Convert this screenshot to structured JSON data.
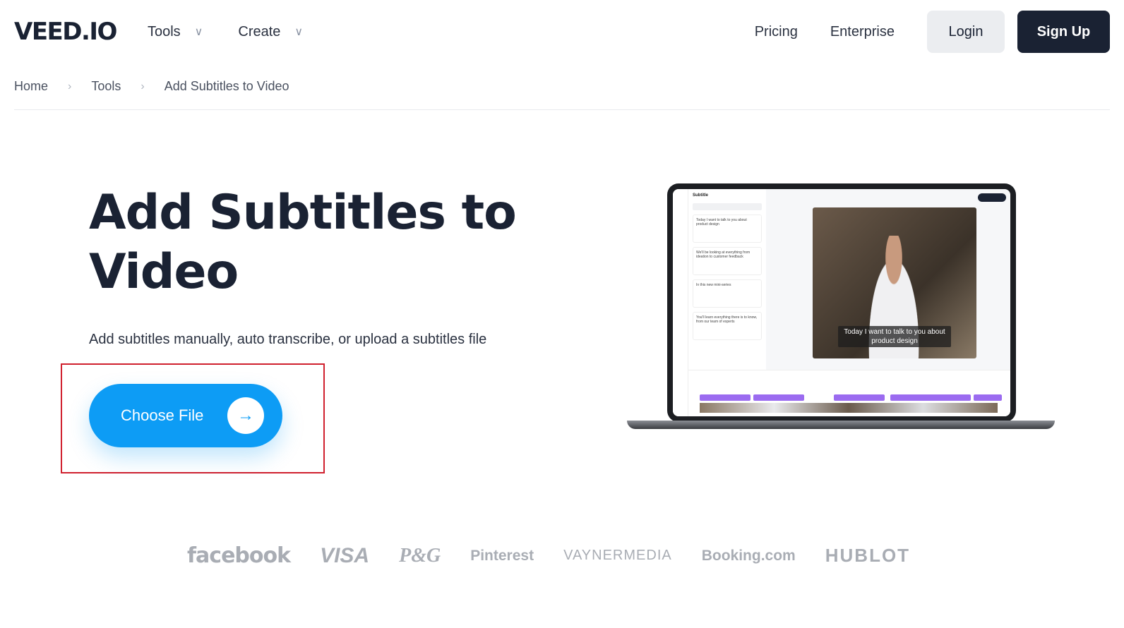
{
  "nav": {
    "logo": "VEED.IO",
    "menus": [
      {
        "label": "Tools"
      },
      {
        "label": "Create"
      }
    ],
    "links": [
      "Pricing",
      "Enterprise"
    ],
    "login": "Login",
    "signup": "Sign Up"
  },
  "breadcrumb": [
    "Home",
    "Tools",
    "Add Subtitles to Video"
  ],
  "hero": {
    "title": "Add Subtitles to Video",
    "subtitle": "Add subtitles manually, auto transcribe, or upload a subtitles file",
    "cta": "Choose File",
    "cta_icon": "arrow-right-icon"
  },
  "mockup": {
    "panel_title": "Subtitle",
    "cards": [
      "Today I want to talk to you about product design",
      "We'll be looking at everything from ideation to customer feedback",
      "In this new mini-series",
      "You'll learn everything there is to know, from our team of experts"
    ],
    "caption": "Today I want to talk to you about product design"
  },
  "logos": [
    "facebook",
    "VISA",
    "P&G",
    "Pinterest",
    "VAYNERMEDIA",
    "Booking.com",
    "HUBLOT"
  ],
  "colors": {
    "primary": "#0d9cf5",
    "dark": "#1a2233",
    "highlight": "#d0202e"
  }
}
